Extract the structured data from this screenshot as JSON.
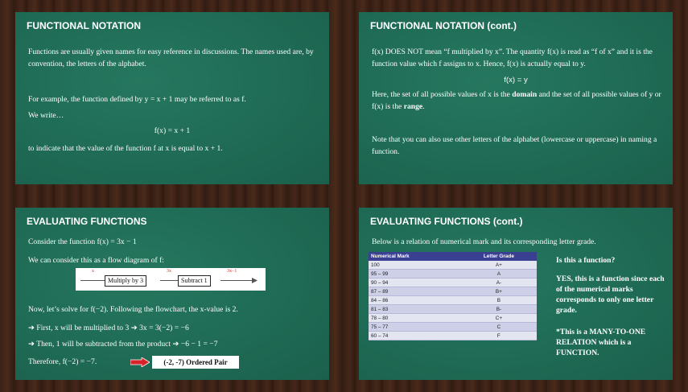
{
  "slides": {
    "s1": {
      "title": "FUNCTIONAL NOTATION",
      "p1": "Functions are usually given names for easy reference in discussions. The names used are, by convention, the letters of the alphabet.",
      "p2": "For example, the function defined by y = x + 1 may be referred to as f.",
      "p3": "We write…",
      "eq": "f(x) = x + 1",
      "p4": "to indicate that the value of the function f  at x is equal to x + 1."
    },
    "s2": {
      "title": "FUNCTIONAL NOTATION (cont.)",
      "p1": "f(x) DOES NOT mean “f multiplied by x”. The quantity f(x) is read as “f of x” and it is the function value which f assigns to x. Hence, f(x) is actually equal to y.",
      "eq": "f(x) = y",
      "p2a": "Here, the set of all possible values of x is the ",
      "p2b": "domain",
      "p2c": " and the set of all possible values of y or f(x) is the ",
      "p2d": "range",
      "p2e": ".",
      "p3": "Note that you can also use other letters of the alphabet (lowercase or uppercase) in naming a function."
    },
    "s3": {
      "title": "EVALUATING FUNCTIONS",
      "p1": "Consider the function f(x) = 3x − 1",
      "p2": "We can consider this as a flow diagram of f:",
      "flow": {
        "in_label": "x",
        "box1": "Multiply by 3",
        "mid_label": "3x",
        "box2": "Subtract 1",
        "out_label": "3x−1"
      },
      "p3": "Now, let’s solve for f(−2). Following the flowchart, the x-value is 2.",
      "p4": "➔ First, x will be multiplied to 3 ➔ 3x = 3(−2) = −6",
      "p5": "➔ Then, 1 will be subtracted from the product ➔ −6  −  1 = −7",
      "p6": "Therefore, f(−2) = −7.",
      "pair": "(-2, -7) Ordered Pair"
    },
    "s4": {
      "title": "EVALUATING FUNCTIONS (cont.)",
      "p1": "Below is a relation of numerical mark and its corresponding letter grade.",
      "table": {
        "headers": [
          "Numerical Mark",
          "Letter Grade"
        ],
        "rows": [
          [
            "100",
            "A+"
          ],
          [
            "95 – 99",
            "A"
          ],
          [
            "90 – 94",
            "A-"
          ],
          [
            "87 – 89",
            "B+"
          ],
          [
            "84 – 86",
            "B"
          ],
          [
            "81 – 83",
            "B-"
          ],
          [
            "78 – 80",
            "C+"
          ],
          [
            "75 – 77",
            "C"
          ],
          [
            "60 – 74",
            "F"
          ]
        ]
      },
      "q": "Is this a function?",
      "ans": "YES, this is a function since each of the numerical marks corresponds to only one letter grade.",
      "note": "*This is a MANY-TO-ONE RELATION which is a FUNCTION."
    }
  },
  "colors": {
    "slide_bg": "#1f6b55",
    "table_header": "#3a3f92",
    "arrow": "#d8232a"
  }
}
